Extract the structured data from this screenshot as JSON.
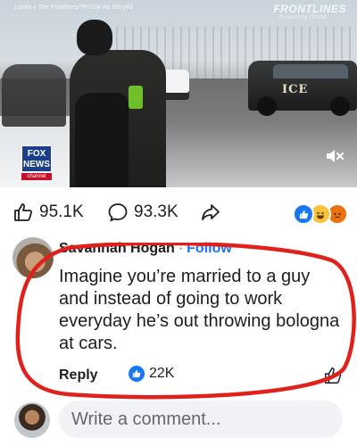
{
  "video": {
    "caption": "Lupita x The Frontlines/TPUSA via Storyful",
    "watermark": "FRONTLINES",
    "watermark_sub": "Powered by TPUSA",
    "vehicle_text": "ICE",
    "logo": {
      "line1": "FOX",
      "line2": "NEWS",
      "band": "channel"
    },
    "mute_icon": "speaker-muted-icon"
  },
  "stats": {
    "likes": "95.1K",
    "comments": "93.3K",
    "like_icon": "thumbs-up-icon",
    "comment_icon": "comment-bubble-icon",
    "share_icon": "share-arrow-icon",
    "reactions": [
      "like-reaction-icon",
      "haha-reaction-icon",
      "angry-reaction-icon"
    ]
  },
  "comment": {
    "author": "Savannah Hogan",
    "separator": "·",
    "follow": "Follow",
    "text": "Imagine you’re married to a guy and instead of going to work everyday he’s out throwing bologna at cars.",
    "reply": "Reply",
    "likes": "22K",
    "accent": "#1877f2",
    "highlight_color": "#e0201a"
  },
  "composer": {
    "placeholder": "Write a comment..."
  }
}
